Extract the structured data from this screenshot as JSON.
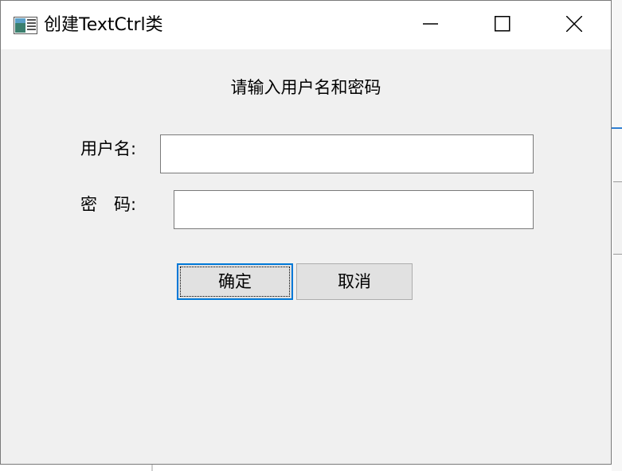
{
  "window": {
    "title": "创建TextCtrl类",
    "icon": "app-window-icon",
    "controls": {
      "minimize_icon": "minimize-icon",
      "maximize_icon": "maximize-icon",
      "close_icon": "close-icon"
    }
  },
  "form": {
    "prompt": "请输入用户名和密码",
    "username_label": "用户名:",
    "username_value": "",
    "password_label": "密　码:",
    "password_value": ""
  },
  "buttons": {
    "ok_label": "确定",
    "cancel_label": "取消"
  },
  "colors": {
    "focus_accent": "#0078d7",
    "dialog_background": "#f0f0f0"
  }
}
